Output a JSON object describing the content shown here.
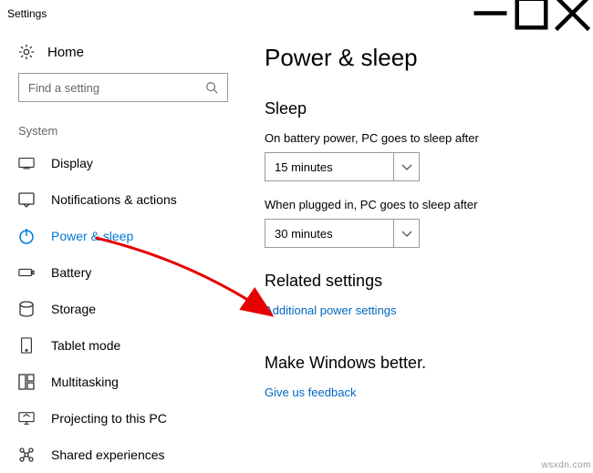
{
  "titlebar": {
    "title": "Settings"
  },
  "home": {
    "label": "Home"
  },
  "search": {
    "placeholder": "Find a setting"
  },
  "sidebar": {
    "section": "System",
    "items": [
      {
        "label": "Display"
      },
      {
        "label": "Notifications & actions"
      },
      {
        "label": "Power & sleep"
      },
      {
        "label": "Battery"
      },
      {
        "label": "Storage"
      },
      {
        "label": "Tablet mode"
      },
      {
        "label": "Multitasking"
      },
      {
        "label": "Projecting to this PC"
      },
      {
        "label": "Shared experiences"
      }
    ]
  },
  "page": {
    "title": "Power & sleep",
    "sleep_heading": "Sleep",
    "battery_label": "On battery power, PC goes to sleep after",
    "battery_value": "15 minutes",
    "plugged_label": "When plugged in, PC goes to sleep after",
    "plugged_value": "30 minutes",
    "related_heading": "Related settings",
    "related_link": "Additional power settings",
    "better_heading": "Make Windows better.",
    "feedback_link": "Give us feedback"
  },
  "watermark": "wsxdn.com"
}
